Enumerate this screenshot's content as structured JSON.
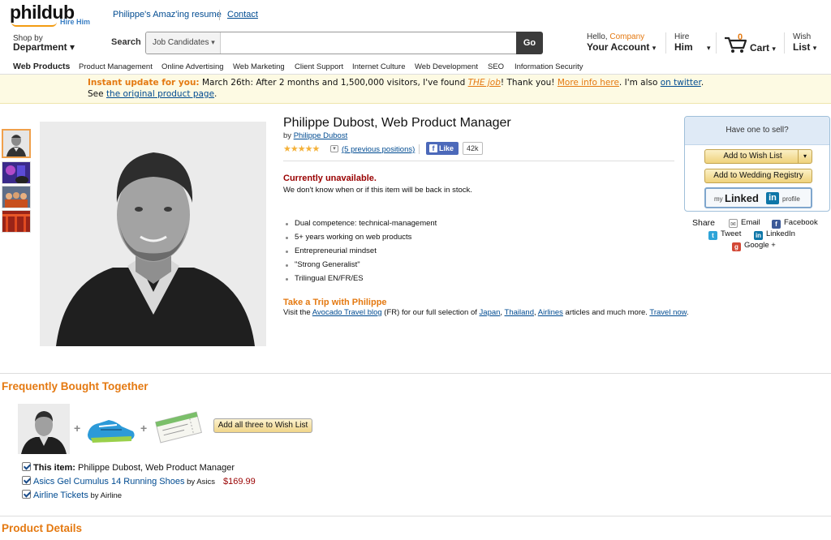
{
  "header": {
    "logo_text": "phildub",
    "logo_sub": "Hire Him",
    "resume_link": "Philippe's Amaz'ing resume",
    "contact_link": "Contact"
  },
  "nav": {
    "shop_by_line1": "Shop by",
    "shop_by_line2": "Department",
    "search_label": "Search",
    "search_category": "Job Candidates",
    "search_value": "",
    "go_label": "Go",
    "account_hello": "Hello,",
    "account_name": "Company",
    "account_label": "Your Account",
    "hire_line1": "Hire",
    "hire_line2": "Him",
    "cart_count": "0",
    "cart_label": "Cart",
    "wish_line1": "Wish",
    "wish_line2": "List"
  },
  "subnav": [
    "Web Products",
    "Product Management",
    "Online Advertising",
    "Web Marketing",
    "Client Support",
    "Internet Culture",
    "Web Development",
    "SEO",
    "Information Security"
  ],
  "banner": {
    "highlight": "Instant update for you:",
    "line1_a": " March 26th: After 2 months and 1,500,000 visitors, I've found ",
    "the_job": "THE job",
    "line1_b": "! Thank you! ",
    "more_info": "More info here",
    "line1_c": ". I'm also ",
    "twitter": "on twitter",
    "line1_d": ".",
    "line2_a": "See ",
    "original_page": "the original product page",
    "line2_b": "."
  },
  "product": {
    "title": "Philippe Dubost, Web Product Manager",
    "by_prefix": "by ",
    "by_author": "Philippe Dubost",
    "stars": "★★★★★",
    "positions": "(5 previous positions)",
    "fb_like": "Like",
    "fb_count": "42k",
    "availability": "Currently unavailable.",
    "availability_sub": "We don't know when or if this item will be back in stock.",
    "bullets": [
      "Dual competence: technical-management",
      "5+ years working on web products",
      "Entrepreneurial mindset",
      "\"Strong Generalist\"",
      "Trilingual EN/FR/ES"
    ],
    "trip_title": "Take a Trip with Philippe",
    "trip_a": "Visit the ",
    "trip_blog": "Avocado Travel blog",
    "trip_b": " (FR) for our full selection of ",
    "trip_japan": "Japan",
    "trip_sep1": ", ",
    "trip_thailand": "Thailand",
    "trip_sep2": ", ",
    "trip_airlines": "Airlines",
    "trip_c": " articles and much more. ",
    "trip_now": "Travel now",
    "trip_d": "."
  },
  "sidebox": {
    "heading": "Have one to sell?",
    "wish_button": "Add to Wish List",
    "wedding_button": "Add to Wedding Registry",
    "li_my": "my",
    "li_linked": "Linked",
    "li_in": "in",
    "li_profile": "profile"
  },
  "share": {
    "label": "Share",
    "email": "Email",
    "facebook": "Facebook",
    "tweet": "Tweet",
    "linkedin": "LinkedIn",
    "google": "Google +"
  },
  "fbt": {
    "title": "Frequently Bought Together",
    "add_all": "Add all three to Wish List",
    "item1_label": "This item:",
    "item1_text": " Philippe Dubost, Web Product Manager",
    "item2_name": "Asics Gel Cumulus 14 Running Shoes",
    "item2_by": " by Asics",
    "item2_price": "$169.99",
    "item3_name": "Airline Tickets",
    "item3_by": " by Airline"
  },
  "details_title": "Product Details",
  "colors": {
    "accent_orange": "#e47911",
    "link_blue": "#004b91",
    "unavailable_red": "#990000",
    "banner_bg": "#fdfae3"
  }
}
